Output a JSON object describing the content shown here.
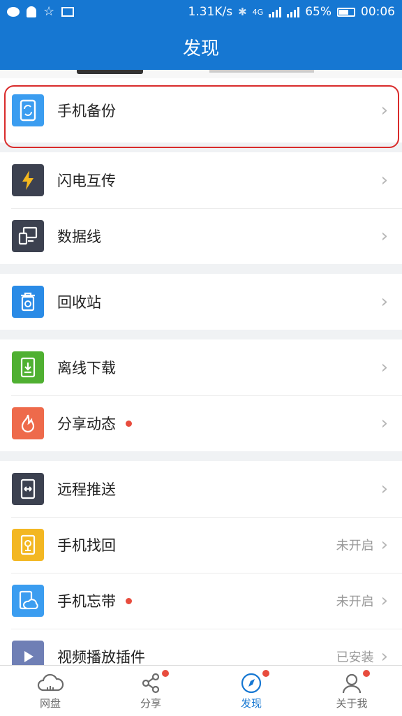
{
  "statusbar": {
    "speed": "1.31K/s",
    "network": "4G",
    "battery": "65%",
    "time": "00:06",
    "battery_level": 0.65
  },
  "header": {
    "title": "发现"
  },
  "groups": [
    [
      {
        "label": "手机备份",
        "icon": "phone-backup-icon",
        "color": "#3b9df0",
        "highlighted": true
      }
    ],
    [
      {
        "label": "闪电互传",
        "icon": "lightning-icon",
        "color": "#3c4150"
      },
      {
        "label": "数据线",
        "icon": "data-cable-icon",
        "color": "#3c4150"
      }
    ],
    [
      {
        "label": "回收站",
        "icon": "recycle-bin-icon",
        "color": "#2a8be6"
      }
    ],
    [
      {
        "label": "离线下载",
        "icon": "offline-download-icon",
        "color": "#4fb031"
      },
      {
        "label": "分享动态",
        "icon": "flame-icon",
        "color": "#ee6a4b",
        "dot": true
      }
    ],
    [
      {
        "label": "远程推送",
        "icon": "remote-push-icon",
        "color": "#3c4150"
      },
      {
        "label": "手机找回",
        "icon": "phone-find-icon",
        "color": "#f3b722",
        "status": "未开启"
      },
      {
        "label": "手机忘带",
        "icon": "phone-forgot-icon",
        "color": "#3b9df0",
        "status": "未开启",
        "dot": true
      },
      {
        "label": "视频播放插件",
        "icon": "video-plugin-icon",
        "color": "#6f7fb5",
        "status": "已安装"
      }
    ]
  ],
  "bottom_nav": [
    {
      "label": "网盘",
      "icon": "cloud-icon",
      "active": false,
      "badge": false
    },
    {
      "label": "分享",
      "icon": "share-icon",
      "active": false,
      "badge": true
    },
    {
      "label": "发现",
      "icon": "compass-icon",
      "active": true,
      "badge": true
    },
    {
      "label": "关于我",
      "icon": "profile-icon",
      "active": false,
      "badge": true
    }
  ],
  "colors": {
    "brand": "#1677d2",
    "badge": "#e84c3d",
    "highlight_border": "#d92b2b"
  }
}
